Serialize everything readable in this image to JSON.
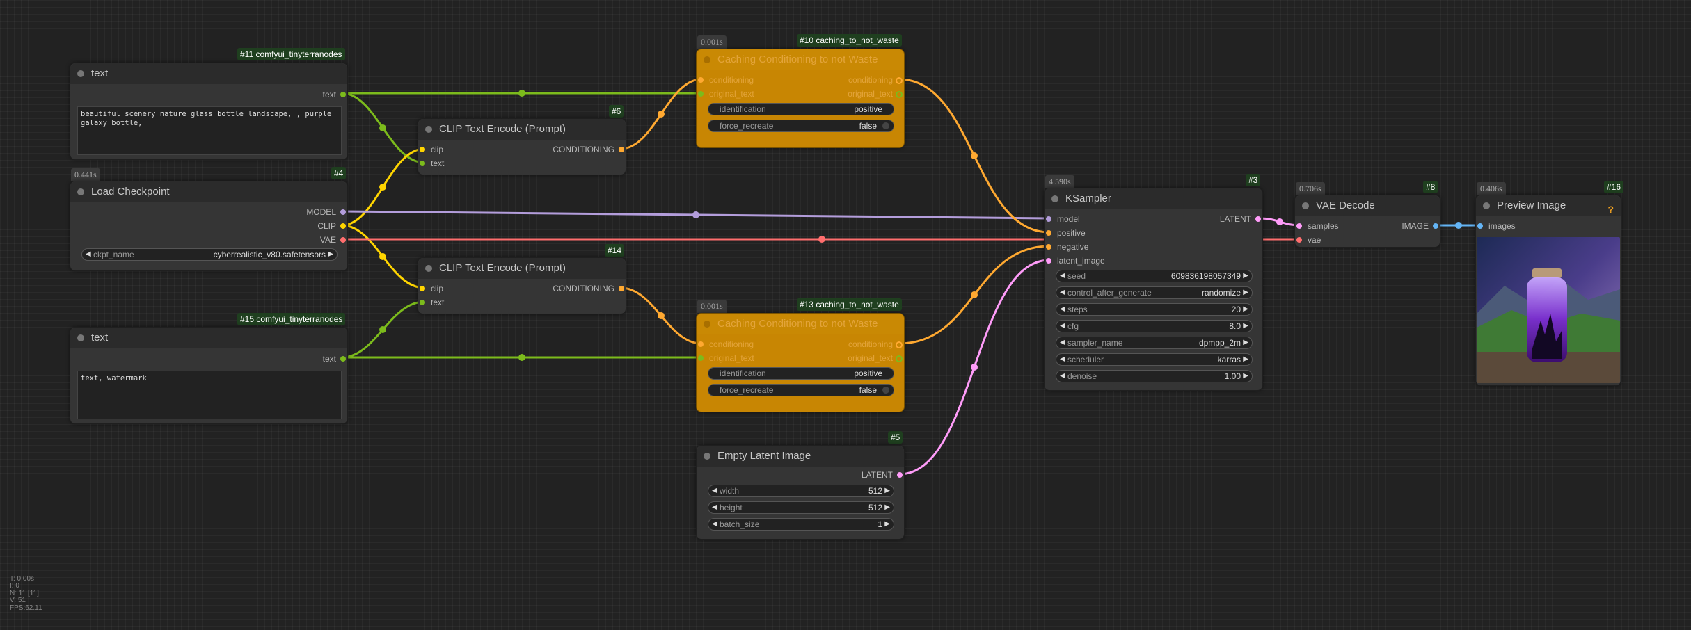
{
  "nodes": {
    "n11": {
      "badge": "#11 comfyui_tinyterranodes",
      "title": "text",
      "out": "text",
      "text": "beautiful scenery nature glass bottle landscape, , purple galaxy bottle,"
    },
    "n15": {
      "badge": "#15 comfyui_tinyterranodes",
      "title": "text",
      "out": "text",
      "text": "text, watermark"
    },
    "n4": {
      "time": "0.441s",
      "id": "#4",
      "title": "Load Checkpoint",
      "outs": [
        "MODEL",
        "CLIP",
        "VAE"
      ],
      "ckpt_label": "ckpt_name",
      "ckpt_value": "cyberrealistic_v80.safetensors"
    },
    "n6": {
      "id": "#6",
      "title": "CLIP Text Encode (Prompt)",
      "in_clip": "clip",
      "in_text": "text",
      "out": "CONDITIONING"
    },
    "n14": {
      "id": "#14",
      "title": "CLIP Text Encode (Prompt)",
      "in_clip": "clip",
      "in_text": "text",
      "out": "CONDITIONING"
    },
    "n10": {
      "time": "0.001s",
      "badge": "#10 caching_to_not_waste",
      "title": "Caching Conditioning to not Waste",
      "in1": "conditioning",
      "in2": "original_text",
      "out1": "conditioning",
      "out2": "original_text",
      "id_label": "identification",
      "id_value": "positive",
      "fr_label": "force_recreate",
      "fr_value": "false"
    },
    "n13": {
      "time": "0.001s",
      "badge": "#13 caching_to_not_waste",
      "title": "Caching Conditioning to not Waste",
      "in1": "conditioning",
      "in2": "original_text",
      "out1": "conditioning",
      "out2": "original_text",
      "id_label": "identification",
      "id_value": "positive",
      "fr_label": "force_recreate",
      "fr_value": "false"
    },
    "n5": {
      "id": "#5",
      "title": "Empty Latent Image",
      "out": "LATENT",
      "widgets": [
        {
          "label": "width",
          "value": "512"
        },
        {
          "label": "height",
          "value": "512"
        },
        {
          "label": "batch_size",
          "value": "1"
        }
      ]
    },
    "n3": {
      "time": "4.590s",
      "id": "#3",
      "title": "KSampler",
      "ins": [
        "model",
        "positive",
        "negative",
        "latent_image"
      ],
      "out": "LATENT",
      "widgets": [
        {
          "label": "seed",
          "value": "609836198057349"
        },
        {
          "label": "control_after_generate",
          "value": "randomize"
        },
        {
          "label": "steps",
          "value": "20"
        },
        {
          "label": "cfg",
          "value": "8.0"
        },
        {
          "label": "sampler_name",
          "value": "dpmpp_2m"
        },
        {
          "label": "scheduler",
          "value": "karras"
        },
        {
          "label": "denoise",
          "value": "1.00"
        }
      ]
    },
    "n8": {
      "time": "0.706s",
      "id": "#8",
      "title": "VAE Decode",
      "in1": "samples",
      "in2": "vae",
      "out": "IMAGE"
    },
    "n16": {
      "time": "0.406s",
      "id": "#16",
      "title": "Preview Image",
      "in": "images",
      "help": "?"
    }
  },
  "stats": [
    "T: 0.00s",
    "I: 0",
    "N: 11 [11]",
    "V: 51",
    "FPS:62.11"
  ],
  "colors": {
    "clip": "#ffd500",
    "model": "#b39ddb",
    "vae": "#ff6e6e",
    "conditioning": "#ffa931",
    "text": "#7cbb1c",
    "latent": "#ff9cf9",
    "image": "#64b5f6",
    "node_orange": "#c88603"
  }
}
